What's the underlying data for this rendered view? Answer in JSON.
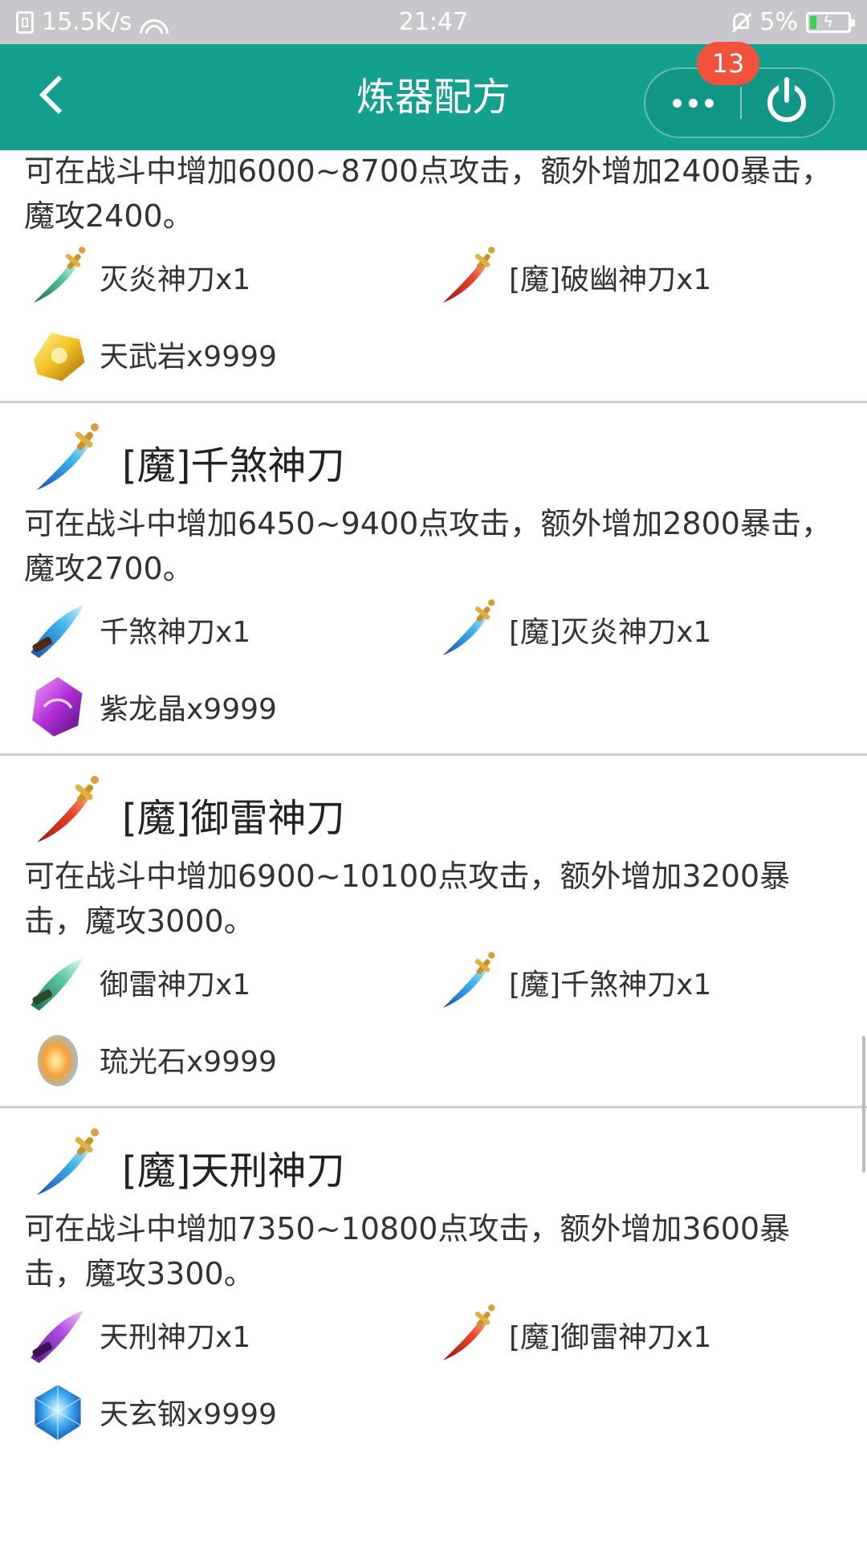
{
  "status_bar": {
    "net_speed": "15.5K/s",
    "time": "21:47",
    "battery": "5%"
  },
  "nav": {
    "title": "炼器配方",
    "badge": "13"
  },
  "recipes": [
    {
      "title": "",
      "desc": "可在战斗中增加6000~8700点攻击，额外增加2400暴击，魔攻2400。",
      "mats": [
        "灭炎神刀x1",
        "[魔]破幽神刀x1",
        "天武岩x9999"
      ]
    },
    {
      "title": "[魔]千煞神刀",
      "desc": "可在战斗中增加6450~9400点攻击，额外增加2800暴击，魔攻2700。",
      "mats": [
        "千煞神刀x1",
        "[魔]灭炎神刀x1",
        "紫龙晶x9999"
      ]
    },
    {
      "title": "[魔]御雷神刀",
      "desc": "可在战斗中增加6900~10100点攻击，额外增加3200暴击，魔攻3000。",
      "mats": [
        "御雷神刀x1",
        "[魔]千煞神刀x1",
        "琉光石x9999"
      ]
    },
    {
      "title": "[魔]天刑神刀",
      "desc": "可在战斗中增加7350~10800点攻击，额外增加3600暴击，魔攻3300。",
      "mats": [
        "天刑神刀x1",
        "[魔]御雷神刀x1",
        "天玄钢x9999"
      ]
    }
  ],
  "colors": {
    "accent": "#13a08c",
    "badge": "#f2513b",
    "status_bar": "#c8c7cc"
  }
}
